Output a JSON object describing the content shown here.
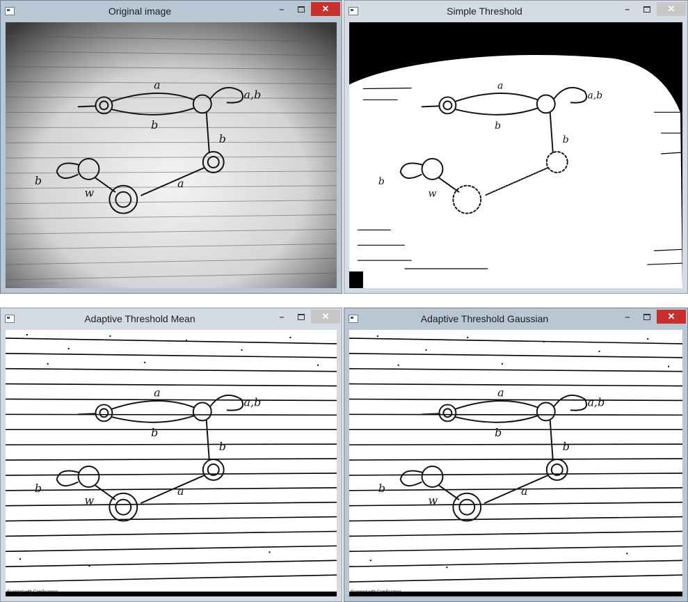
{
  "windows": [
    {
      "id": "original",
      "title": "Original image",
      "active": true
    },
    {
      "id": "simple",
      "title": "Simple Threshold",
      "active": false
    },
    {
      "id": "mean",
      "title": "Adaptive Threshold Mean",
      "active": false
    },
    {
      "id": "gaussian",
      "title": "Adaptive Threshold Gaussian",
      "active": true
    }
  ],
  "controls": {
    "minimize": "–",
    "close": "✕"
  },
  "diagram_labels": {
    "a_top": "a",
    "ab_loop": "a,b",
    "b_bottom": "b",
    "b_right": "b",
    "a_diag": "a",
    "w_loop": "b",
    "w_edge": "w"
  },
  "footer_text": "Scanned with CamScanner"
}
